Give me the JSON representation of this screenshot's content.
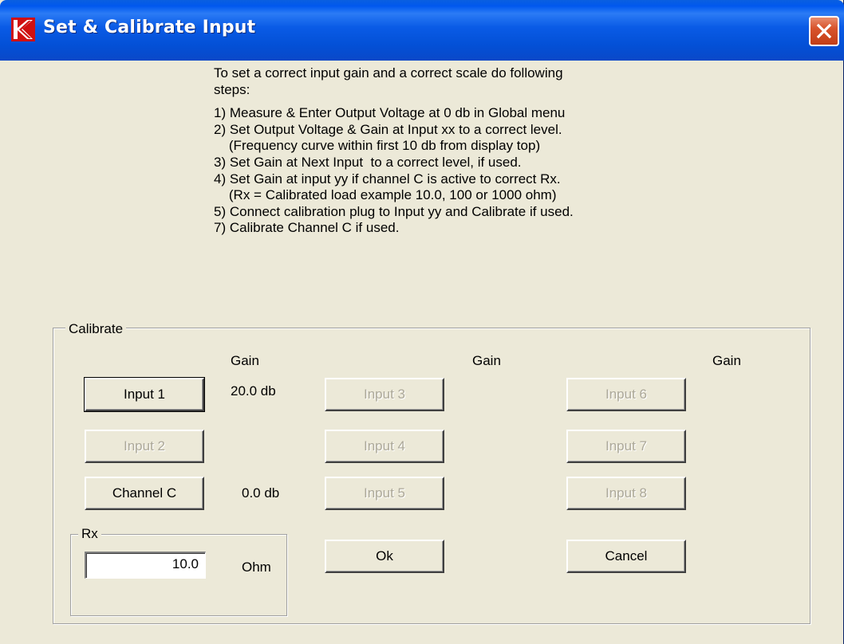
{
  "window": {
    "title": "Set & Calibrate Input",
    "title_bar_color": "#0a5be6",
    "close_icon": "close-icon",
    "app_icon": "app-logo-icon"
  },
  "instructions": {
    "intro_1": "To set a correct input gain and a correct scale do following",
    "intro_2": "steps:",
    "steps": [
      "1) Measure & Enter Output Voltage at 0 db in Global menu",
      "2) Set Output Voltage & Gain at Input xx to a correct level.",
      "    (Frequency curve within first 10 db from display top)",
      "3) Set Gain at Next Input  to a correct level, if used.",
      "4) Set Gain at input yy if channel C is active to correct Rx.",
      "    (Rx = Calibrated load example 10.0, 100 or 1000 ohm)",
      "5) Connect calibration plug to Input yy and Calibrate if used.",
      "7) Calibrate Channel C if used."
    ]
  },
  "calibrate": {
    "group_label": "Calibrate",
    "gain_header_1": "Gain",
    "gain_header_2": "Gain",
    "gain_header_3": "Gain",
    "input1_label": "Input 1",
    "input1_gain": "20.0 db",
    "input2_label": "Input 2",
    "channel_c_label": "Channel C",
    "channel_c_gain": "0.0 db",
    "input3_label": "Input 3",
    "input4_label": "Input 4",
    "input5_label": "Input 5",
    "input6_label": "Input 6",
    "input7_label": "Input 7",
    "input8_label": "Input 8",
    "disabled_text_color": "#aca899"
  },
  "rx": {
    "group_label": "Rx",
    "value": "10.0",
    "unit": "Ohm"
  },
  "actions": {
    "ok_label": "Ok",
    "cancel_label": "Cancel"
  }
}
